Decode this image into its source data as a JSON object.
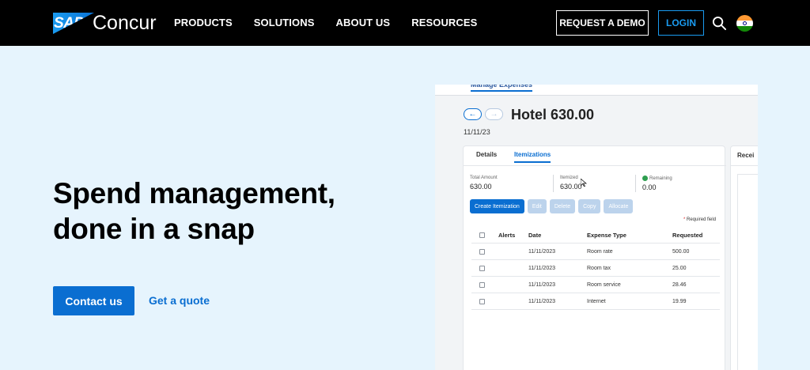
{
  "header": {
    "logo_badge": "SAP",
    "logo_word": "Concur",
    "nav": [
      "PRODUCTS",
      "SOLUTIONS",
      "ABOUT US",
      "RESOURCES"
    ],
    "demo_label": "REQUEST A DEMO",
    "login_label": "LOGIN",
    "search_icon": "search-icon",
    "flag_icon": "india-flag-icon"
  },
  "hero": {
    "title": "Spend management, done in a snap",
    "contact_label": "Contact us",
    "quote_label": "Get a quote"
  },
  "app": {
    "top_tab": "Manage Expenses",
    "title": "Hotel 630.00",
    "date": "11/11/23",
    "tabs": [
      "Details",
      "Itemizations"
    ],
    "summary": {
      "total_label": "Total Amount",
      "total_value": "630.00",
      "itemized_label": "Itemized",
      "itemized_value": "630.00",
      "remaining_label": "Remaining",
      "remaining_value": "0.00"
    },
    "actions": [
      "Create Itemization",
      "Edit",
      "Delete",
      "Copy",
      "Allocate"
    ],
    "required_note": "Required field",
    "columns": [
      "Alerts",
      "Date",
      "Expense Type",
      "Requested"
    ],
    "rows": [
      {
        "date": "11/11/2023",
        "type": "Room rate",
        "amount": "500.00"
      },
      {
        "date": "11/11/2023",
        "type": "Room tax",
        "amount": "25.00"
      },
      {
        "date": "11/11/2023",
        "type": "Room service",
        "amount": "28.46"
      },
      {
        "date": "11/11/2023",
        "type": "Internet",
        "amount": "19.99"
      }
    ],
    "side_label": "Recei"
  },
  "colors": {
    "header_bg": "#000000",
    "hero_bg": "#e6f4fd",
    "accent": "#0a6ed1",
    "login_border": "#1a9bf0"
  }
}
